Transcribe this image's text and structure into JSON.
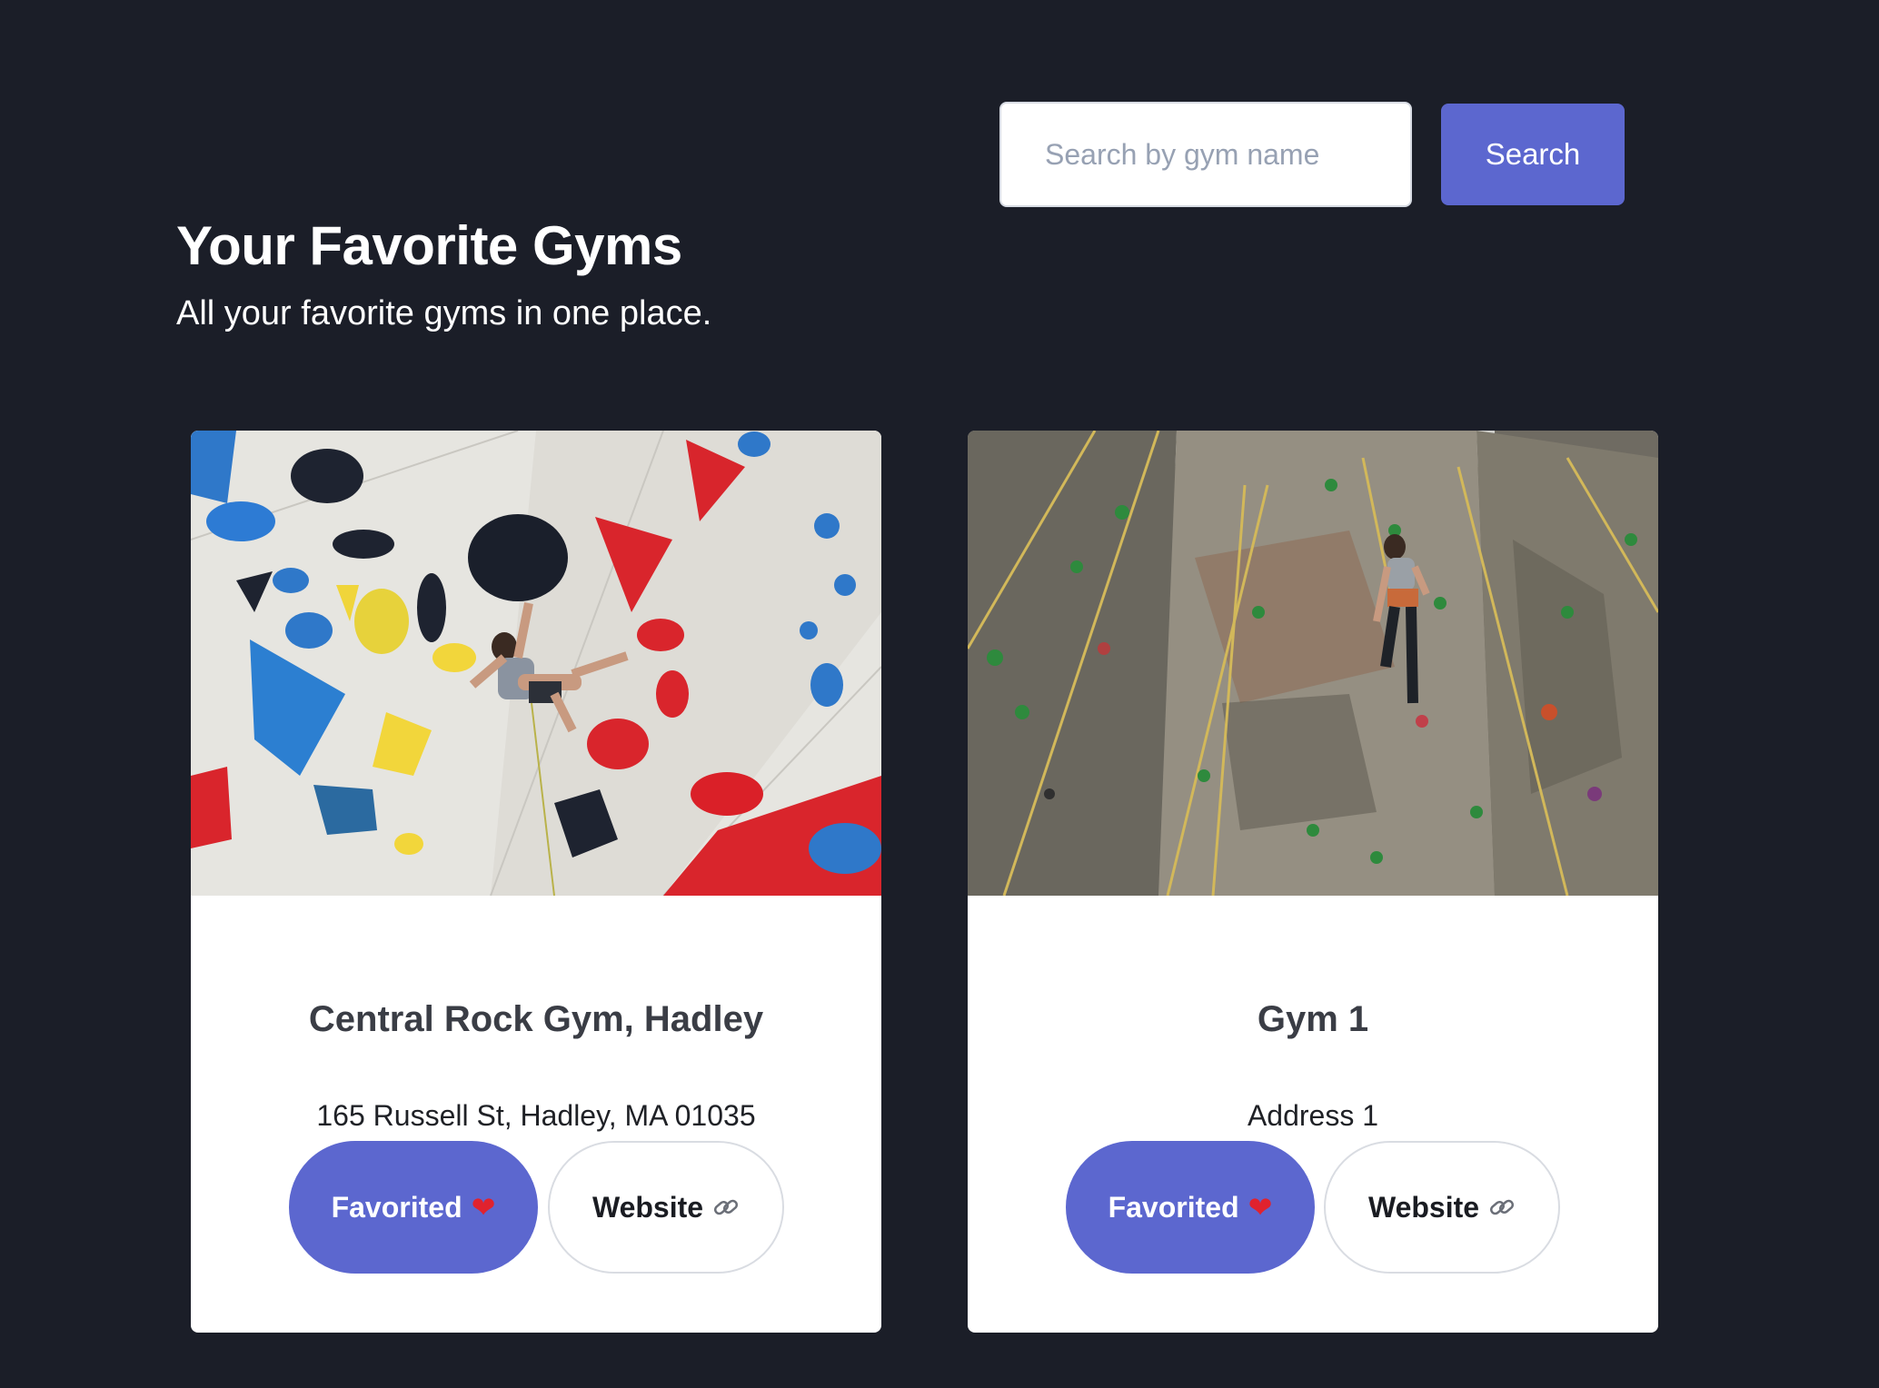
{
  "search": {
    "placeholder": "Search by gym name",
    "value": "",
    "button_label": "Search"
  },
  "header": {
    "title": "Your Favorite Gyms",
    "subtitle": "All your favorite gyms in one place."
  },
  "gyms": [
    {
      "name": "Central Rock Gym, Hadley",
      "address": "165 Russell St, Hadley, MA 01035",
      "favorite_label": "Favorited",
      "favorite_icon": "heart-icon",
      "website_label": "Website",
      "website_icon": "link-icon",
      "image": "bouldering wall with colorful holds"
    },
    {
      "name": "Gym 1",
      "address": "Address 1",
      "favorite_label": "Favorited",
      "favorite_icon": "heart-icon",
      "website_label": "Website",
      "website_icon": "link-icon",
      "image": "tall rock climbing wall with ropes"
    }
  ],
  "colors": {
    "background": "#1b1e28",
    "accent": "#5c67cf",
    "card": "#ffffff",
    "heart": "#e0222e"
  }
}
